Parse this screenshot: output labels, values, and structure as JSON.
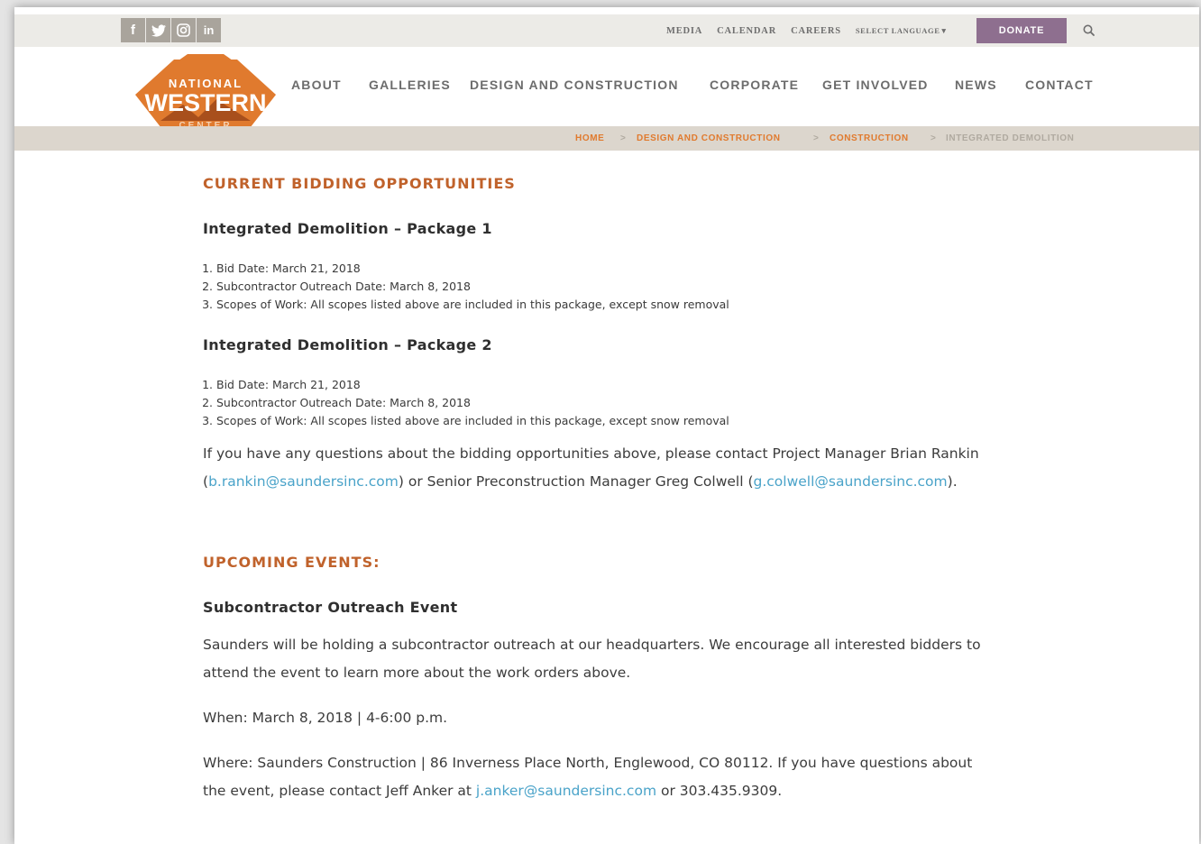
{
  "topbar": {
    "social": [
      {
        "icon": "facebook-icon",
        "glyph": "f"
      },
      {
        "icon": "twitter-icon",
        "glyph": "🐦"
      },
      {
        "icon": "instagram-icon",
        "glyph": "◎"
      },
      {
        "icon": "linkedin-icon",
        "glyph": "in"
      }
    ],
    "links": [
      "MEDIA",
      "CALENDAR",
      "CAREERS"
    ],
    "language": "SELECT LANGUAGE▼",
    "donate": "DONATE"
  },
  "logo": {
    "line1": "NATIONAL",
    "line2": "WESTERN",
    "line3": "CENTER"
  },
  "nav": [
    "ABOUT",
    "GALLERIES",
    "DESIGN AND CONSTRUCTION",
    "CORPORATE",
    "GET INVOLVED",
    "NEWS",
    "CONTACT"
  ],
  "breadcrumb": {
    "items": [
      "HOME",
      "DESIGN AND CONSTRUCTION",
      "CONSTRUCTION",
      "INTEGRATED DEMOLITION"
    ],
    "separator": ">"
  },
  "content": {
    "bidding_heading": "CURRENT BIDDING OPPORTUNITIES",
    "package1": {
      "title": "Integrated Demolition – Package 1",
      "items": [
        "Bid Date: March 21, 2018",
        "Subcontractor Outreach Date: March 8, 2018",
        "Scopes of Work: All scopes listed above are included in this package, except snow removal"
      ]
    },
    "package2": {
      "title": "Integrated Demolition – Package 2",
      "items": [
        "Bid Date: March 21, 2018",
        "Subcontractor Outreach Date: March 8, 2018",
        "Scopes of Work: All scopes listed above are included in this package, except snow removal"
      ]
    },
    "contact_para": {
      "text1": "If you have any questions about the bidding opportunities above, please contact Project Manager Brian Rankin (",
      "email1": "b.rankin@saundersinc.com",
      "text2": ") or Senior Preconstruction Manager Greg Colwell (",
      "email2": "g.colwell@saundersinc.com",
      "text3": ")."
    },
    "events_heading": "UPCOMING EVENTS:",
    "event_title": "Subcontractor Outreach Event",
    "event_desc": "Saunders will be holding a subcontractor outreach at our headquarters. We encourage all interested bidders to attend the event to learn more about the work orders above.",
    "when": "When: March 8, 2018 | 4-6:00 p.m.",
    "where": {
      "text1": "Where: Saunders Construction | 86 Inverness Place North, Englewood, CO 80112. If you have questions about the event, please contact Jeff Anker at ",
      "email": "j.anker@saundersinc.com",
      "text2": " or 303.435.9309."
    }
  },
  "colors": {
    "accent_orange": "#e07a2e",
    "heading_rust": "#c0622b",
    "donate_purple": "#8e6f8f",
    "link_blue": "#4aa3c9",
    "crumb_bar": "#dcd6cd"
  }
}
